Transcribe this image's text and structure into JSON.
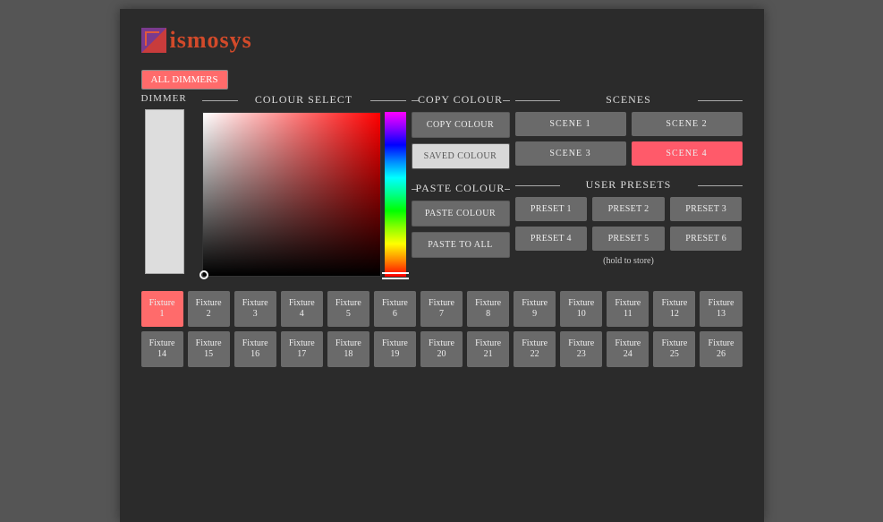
{
  "brand": "ismosys",
  "allDimmersLabel": "ALL DIMMERS",
  "sections": {
    "dimmer": "DIMMER",
    "colourSelect": "COLOUR SELECT",
    "copyColour": "COPY COLOUR",
    "pasteColour": "PASTE COLOUR",
    "scenes": "SCENES",
    "userPresets": "USER PRESETS"
  },
  "buttons": {
    "copyColour": "COPY COLOUR",
    "savedColour": "SAVED COLOUR",
    "pasteColour": "PASTE COLOUR",
    "pasteToAll": "PASTE TO ALL"
  },
  "scenes": [
    {
      "label": "SCENE 1",
      "active": false
    },
    {
      "label": "SCENE 2",
      "active": false
    },
    {
      "label": "SCENE 3",
      "active": false
    },
    {
      "label": "SCENE 4",
      "active": true
    }
  ],
  "presets": [
    {
      "label": "PRESET 1"
    },
    {
      "label": "PRESET 2"
    },
    {
      "label": "PRESET 3"
    },
    {
      "label": "PRESET 4"
    },
    {
      "label": "PRESET 5"
    },
    {
      "label": "PRESET 6"
    }
  ],
  "holdNote": "(hold to store)",
  "fixtureNameWord": "Fixture",
  "fixtures": [
    {
      "num": 1,
      "active": true
    },
    {
      "num": 2
    },
    {
      "num": 3
    },
    {
      "num": 4
    },
    {
      "num": 5
    },
    {
      "num": 6
    },
    {
      "num": 7
    },
    {
      "num": 8
    },
    {
      "num": 9
    },
    {
      "num": 10
    },
    {
      "num": 11
    },
    {
      "num": 12
    },
    {
      "num": 13
    },
    {
      "num": 14
    },
    {
      "num": 15
    },
    {
      "num": 16
    },
    {
      "num": 17
    },
    {
      "num": 18
    },
    {
      "num": 19
    },
    {
      "num": 20
    },
    {
      "num": 21
    },
    {
      "num": 22
    },
    {
      "num": 23
    },
    {
      "num": 24
    },
    {
      "num": 25
    },
    {
      "num": 26
    }
  ]
}
